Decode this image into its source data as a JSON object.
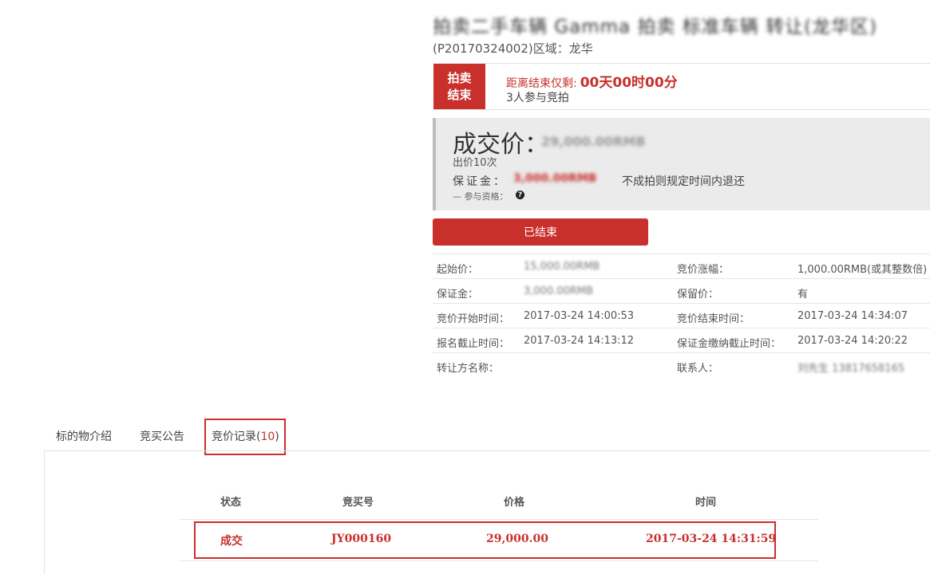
{
  "header": {
    "title_obscured": "拍卖二手车辆 Gamma 拍卖 标准车辆 转让(龙华区)",
    "subtitle": "(P20170324002)区域：龙华"
  },
  "status": {
    "badge": "拍卖结束",
    "countdown_label": "距离结束仅剩:",
    "countdown_value": "00天00时00分",
    "participants": "3人参与竞拍"
  },
  "price": {
    "deal_label": "成交价：",
    "deal_amount_obscured": "29,000.00RMB",
    "bid_count": "出价10次",
    "deposit_label": "保证金：",
    "deposit_amount_obscured": "3,000.00RMB",
    "deposit_note": "不成拍则规定时间内退还",
    "qualification_label": "— 参与资格：",
    "qualification_icon": "question-circle-icon"
  },
  "actions": {
    "ended_button": "已结束"
  },
  "info": {
    "rows": [
      {
        "l1": "起始价：",
        "v1": "15,000.00RMB",
        "l2": "竞价涨幅：",
        "v2": "1,000.00RMB(或其整数倍)"
      },
      {
        "l1": "保证金：",
        "v1": "3,000.00RMB",
        "l2": "保留价：",
        "v2": "有"
      },
      {
        "l1": "竞价开始时间：",
        "v1": "2017-03-24 14:00:53",
        "l2": "竞价结束时间：",
        "v2": "2017-03-24 14:34:07"
      },
      {
        "l1": "报名截止时间：",
        "v1": "2017-03-24 14:13:12",
        "l2": "保证金缴纳截止时间：",
        "v2": "2017-03-24 14:20:22"
      },
      {
        "l1": "转让方名称：",
        "v1": "",
        "l2": "联系人：",
        "v2": "刘先生 13817658165"
      }
    ]
  },
  "tabs": {
    "items": [
      "标的物介绍",
      "竞买公告",
      "竞价记录("
    ],
    "active_count": "10",
    "active_close": ")"
  },
  "records": {
    "headers": [
      "状态",
      "竞买号",
      "价格",
      "时间"
    ],
    "rows": [
      {
        "status": "成交",
        "bidder": "JY000160",
        "price": "29,000.00",
        "time": "2017-03-24 14:31:59"
      }
    ]
  },
  "colors": {
    "accent": "#c9302c",
    "panel": "#ebebeb"
  }
}
